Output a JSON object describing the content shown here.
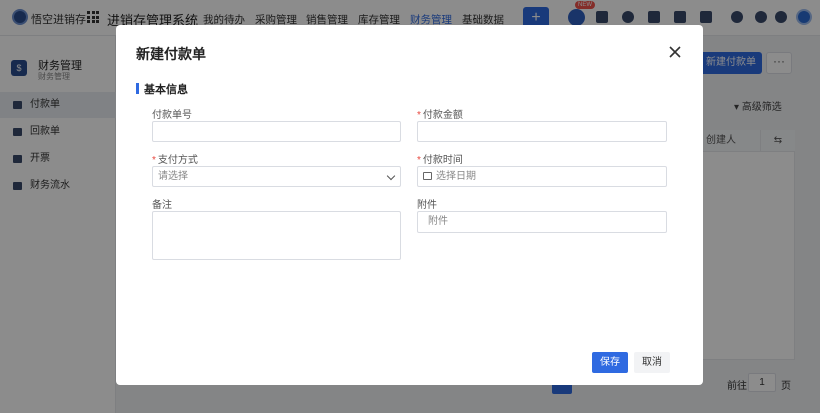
{
  "app": {
    "brand": "悟空进销存",
    "system_title": "进销存管理系统"
  },
  "nav": {
    "items": [
      "我的待办",
      "采购管理",
      "销售管理",
      "库存管理",
      "财务管理",
      "基础数据"
    ],
    "active": "财务管理",
    "new_badge": "NEW",
    "plus_label": "+"
  },
  "sidebar": {
    "title": "财务管理",
    "subtitle": "财务管理",
    "head_icon": "$",
    "items": [
      "付款单",
      "回款单",
      "开票",
      "财务流水"
    ],
    "active": "付款单"
  },
  "content": {
    "new_button": "新建付款单",
    "more_button": "···",
    "filter_label": "高级筛选",
    "column_creator": "创建人",
    "pager_goto": "前往",
    "pager_value": "1",
    "pager_unit": "页"
  },
  "modal": {
    "title": "新建付款单",
    "section": "基本信息",
    "fields": {
      "pay_no": {
        "label": "付款单号",
        "value": ""
      },
      "amount": {
        "label": "付款金额",
        "required": true,
        "value": ""
      },
      "method": {
        "label": "支付方式",
        "required": true,
        "placeholder": "请选择"
      },
      "time": {
        "label": "付款时间",
        "required": true,
        "placeholder": "选择日期"
      },
      "remark": {
        "label": "备注",
        "value": ""
      },
      "attachment": {
        "label": "附件",
        "placeholder": "附件"
      }
    },
    "save": "保存",
    "cancel": "取消"
  },
  "colors": {
    "primary": "#2f6ae1",
    "required": "#e8483f",
    "overlay": "rgba(0,0,0,0.45)"
  }
}
